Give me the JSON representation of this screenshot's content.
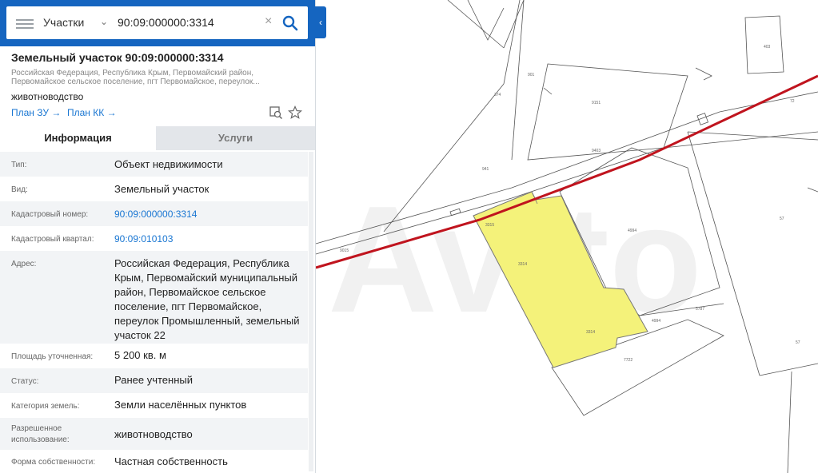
{
  "search": {
    "type_label": "Участки",
    "query": "90:09:000000:3314"
  },
  "parcel": {
    "title": "Земельный участок 90:09:000000:3314",
    "address_short": "Российская Федерация, Республика Крым, Первомайский район, Первомайское сельское поселение, пгт Первомайское, переулок...",
    "usage": "животноводство",
    "link_plan_zu": "План ЗУ",
    "link_plan_kk": "План КК"
  },
  "tabs": {
    "info": "Информация",
    "services": "Услуги"
  },
  "fields": [
    {
      "label": "Тип:",
      "value": "Объект недвижимости"
    },
    {
      "label": "Вид:",
      "value": "Земельный участок"
    },
    {
      "label": "Кадастровый номер:",
      "value": "90:09:000000:3314"
    },
    {
      "label": "Кадастровый квартал:",
      "value": "90:09:010103"
    },
    {
      "label": "Адрес:",
      "value": "Российская Федерация, Республика Крым, Первомайский муниципальный район, Первомайское сельское поселение, пгт Первомайское, переулок Промышленный, земельный участок 22"
    },
    {
      "label": "Площадь уточненная:",
      "value": "5 200 кв. м"
    },
    {
      "label": "Статус:",
      "value": "Ранее учтенный"
    },
    {
      "label": "Категория земель:",
      "value": "Земли населённых пунктов"
    },
    {
      "label": "Разрешенное использование:",
      "value": "животноводство"
    },
    {
      "label": "Форма собственности:",
      "value": "Частная собственность"
    }
  ],
  "colors": {
    "accent": "#1565c0",
    "link": "#1976d2",
    "parcel_fill": "#f4f27a",
    "road_line": "#c0141e"
  }
}
